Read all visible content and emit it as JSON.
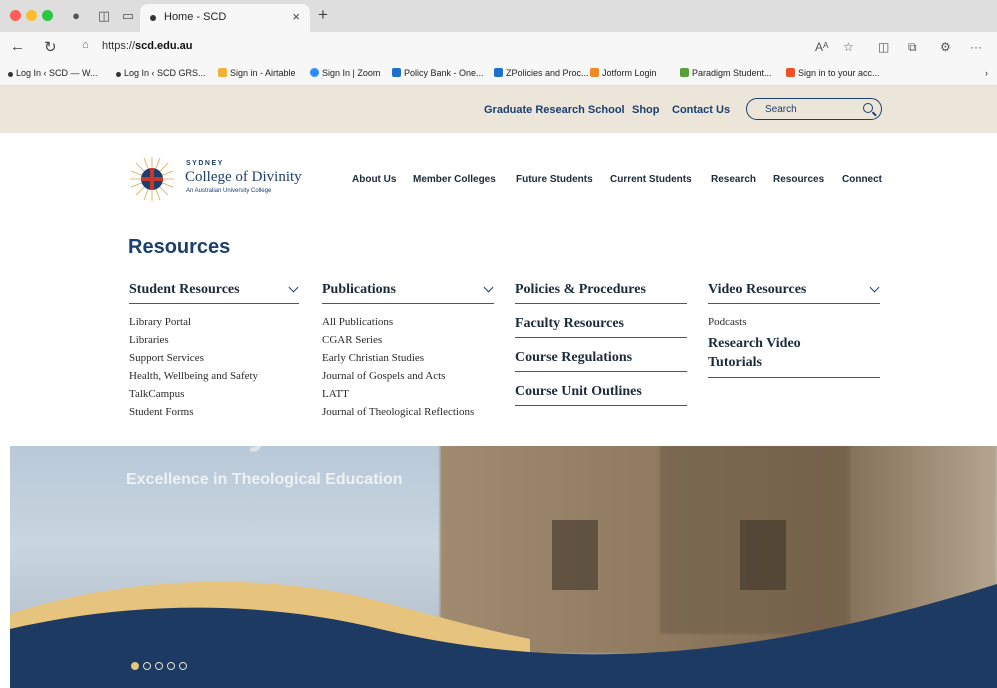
{
  "browser": {
    "tab_title": "Home - SCD",
    "tab_close": "×",
    "new_tab": "+",
    "url_prefix": "https://",
    "url_host": "scd.edu.au",
    "bookmarks": [
      "Log In ‹ SCD — W...",
      "Log In ‹ SCD GRS...",
      "Sign in - Airtable",
      "Sign In | Zoom",
      "Policy Bank - One...",
      "ZPolicies and Proc...",
      "Jotform Login",
      "Paradigm Student...",
      "Sign in to your acc..."
    ],
    "bookmark_overflow": "›"
  },
  "topbar": {
    "links": [
      "Graduate Research School",
      "Shop",
      "Contact Us"
    ],
    "search_placeholder": "Search"
  },
  "logo": {
    "small": "SYDNEY",
    "main": "College of Divinity",
    "sub": "An Australian University College"
  },
  "mainnav": [
    "About Us",
    "Member Colleges",
    "Future Students",
    "Current Students",
    "Research",
    "Resources",
    "Connect"
  ],
  "mega": {
    "title": "Resources",
    "student_resources": {
      "heading": "Student Resources",
      "items": [
        "Library Portal",
        "Libraries",
        "Support Services",
        "Health, Wellbeing and Safety",
        "TalkCampus",
        "Student Forms"
      ]
    },
    "publications": {
      "heading": "Publications",
      "items": [
        "All Publications",
        "CGAR Series",
        "Early Christian Studies",
        "Journal of Gospels and Acts",
        "LATT",
        "Journal of Theological Reflections"
      ]
    },
    "policies": {
      "heading": "Policies & Procedures",
      "items": [
        "Faculty Resources",
        "Course Regulations",
        "Course Unit Outlines"
      ]
    },
    "video": {
      "heading": "Video Resources",
      "podcasts": "Podcasts",
      "tutorials_line1": "Research Video",
      "tutorials_line2": "Tutorials"
    }
  },
  "hero": {
    "big_text": "Divinity",
    "tagline": "Excellence in Theological Education",
    "slide_count": 5,
    "active_slide": 1
  },
  "colors": {
    "navy": "#1c3f6e",
    "sand": "#ebe5da",
    "gold": "#e7c47d",
    "wave_navy": "#1d3a63"
  }
}
